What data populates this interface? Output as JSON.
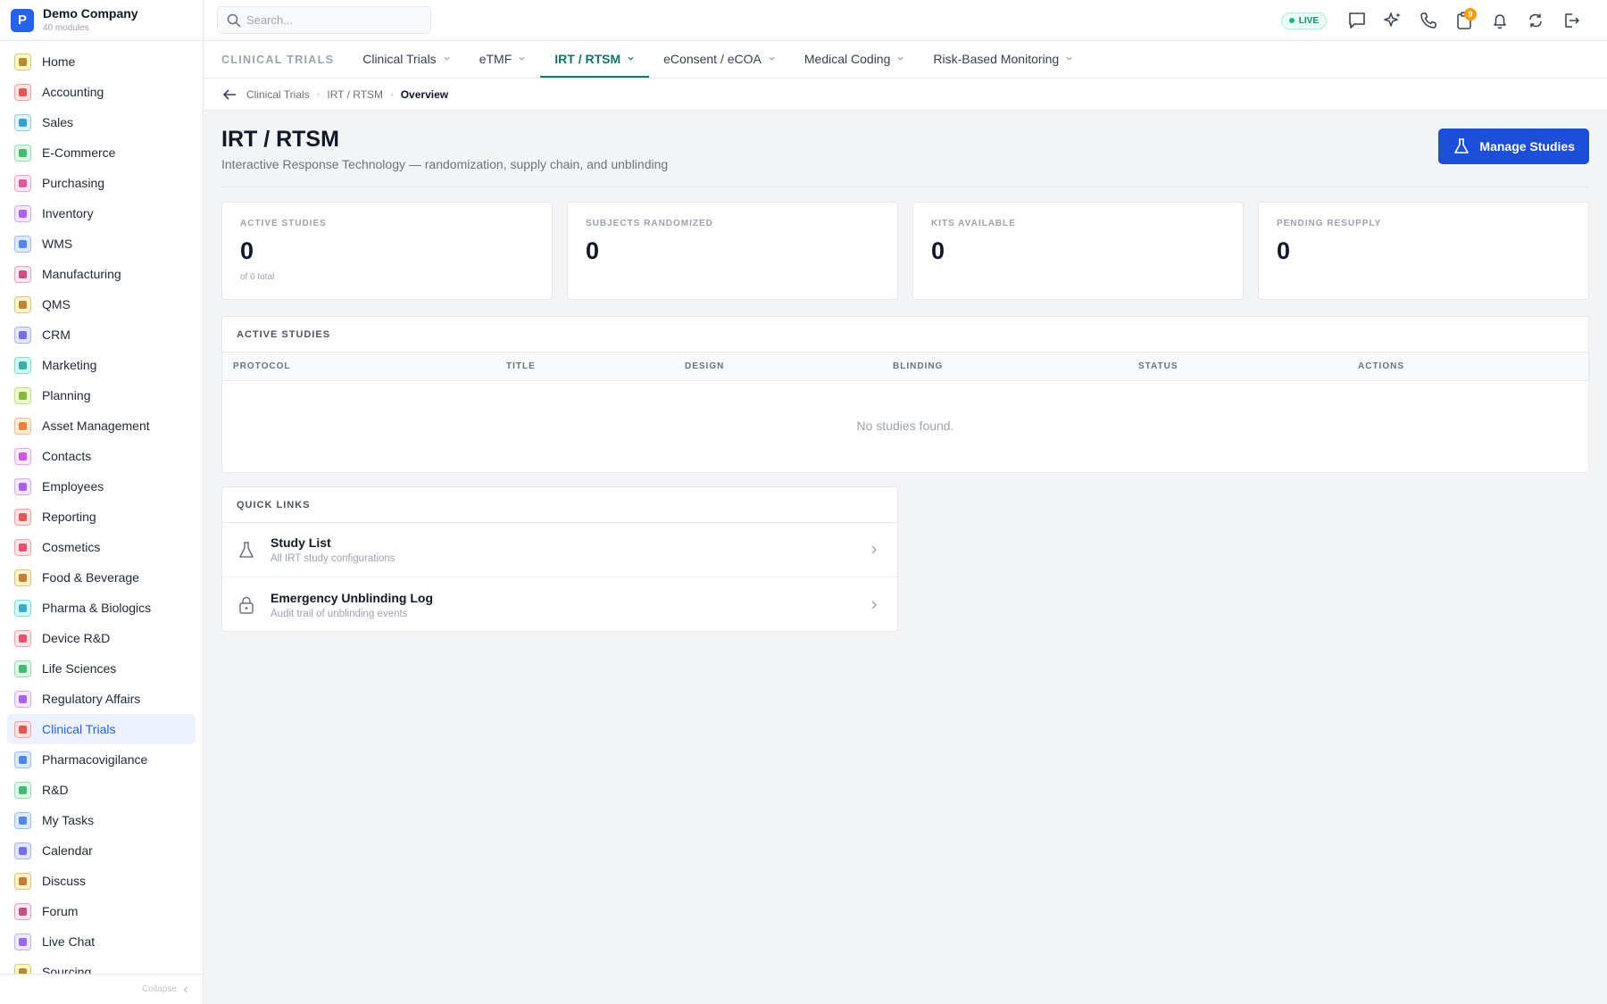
{
  "company": {
    "initial": "P",
    "name": "Demo Company",
    "modules": "40 modules"
  },
  "sidebar": {
    "items": [
      {
        "label": "Home",
        "icon": "home-icon",
        "color": "#a16207",
        "bg": "#fef9c3"
      },
      {
        "label": "Accounting",
        "icon": "bank-icon",
        "color": "#dc2626",
        "bg": "#fee2e2"
      },
      {
        "label": "Sales",
        "icon": "sales-icon",
        "color": "#0284c7",
        "bg": "#e0f2fe"
      },
      {
        "label": "E-Commerce",
        "icon": "store-icon",
        "color": "#16a34a",
        "bg": "#dcfce7"
      },
      {
        "label": "Purchasing",
        "icon": "cart-icon",
        "color": "#db2777",
        "bg": "#fce7f3"
      },
      {
        "label": "Inventory",
        "icon": "box-icon",
        "color": "#9333ea",
        "bg": "#f3e8ff"
      },
      {
        "label": "WMS",
        "icon": "warehouse-icon",
        "color": "#2563eb",
        "bg": "#dbeafe"
      },
      {
        "label": "Manufacturing",
        "icon": "factory-icon",
        "color": "#be185d",
        "bg": "#fce7f3"
      },
      {
        "label": "QMS",
        "icon": "check-circle-icon",
        "color": "#a16207",
        "bg": "#fef3c7"
      },
      {
        "label": "CRM",
        "icon": "users-icon",
        "color": "#4f46e5",
        "bg": "#e0e7ff"
      },
      {
        "label": "Marketing",
        "icon": "megaphone-icon",
        "color": "#0d9488",
        "bg": "#ccfbf1"
      },
      {
        "label": "Planning",
        "icon": "calendar-grid-icon",
        "color": "#65a30d",
        "bg": "#ecfccb"
      },
      {
        "label": "Asset Management",
        "icon": "tools-icon",
        "color": "#ea580c",
        "bg": "#ffedd5"
      },
      {
        "label": "Contacts",
        "icon": "contact-card-icon",
        "color": "#c026d3",
        "bg": "#fae8ff"
      },
      {
        "label": "Employees",
        "icon": "badge-icon",
        "color": "#9333ea",
        "bg": "#f3e8ff"
      },
      {
        "label": "Reporting",
        "icon": "bar-chart-icon",
        "color": "#dc2626",
        "bg": "#fee2e2"
      },
      {
        "label": "Cosmetics",
        "icon": "lotus-icon",
        "color": "#e11d48",
        "bg": "#ffe4e6"
      },
      {
        "label": "Food & Beverage",
        "icon": "utensils-icon",
        "color": "#b45309",
        "bg": "#fef3c7"
      },
      {
        "label": "Pharma & Biologics",
        "icon": "pill-icon",
        "color": "#0891b2",
        "bg": "#cffafe"
      },
      {
        "label": "Device R&D",
        "icon": "device-icon",
        "color": "#e11d48",
        "bg": "#ffe4e6"
      },
      {
        "label": "Life Sciences",
        "icon": "microscope-icon",
        "color": "#16a34a",
        "bg": "#dcfce7"
      },
      {
        "label": "Regulatory Affairs",
        "icon": "gavel-icon",
        "color": "#9333ea",
        "bg": "#f3e8ff"
      },
      {
        "label": "Clinical Trials",
        "icon": "clipboard-icon",
        "color": "#dc2626",
        "bg": "#fee2e2",
        "active": true
      },
      {
        "label": "Pharmacovigilance",
        "icon": "shield-icon",
        "color": "#2563eb",
        "bg": "#dbeafe"
      },
      {
        "label": "R&D",
        "icon": "flask-icon",
        "color": "#16a34a",
        "bg": "#dcfce7"
      },
      {
        "label": "My Tasks",
        "icon": "checklist-icon",
        "color": "#2563eb",
        "bg": "#dbeafe"
      },
      {
        "label": "Calendar",
        "icon": "calendar-icon",
        "color": "#4f46e5",
        "bg": "#e0e7ff"
      },
      {
        "label": "Discuss",
        "icon": "chat-icon",
        "color": "#b45309",
        "bg": "#fef3c7"
      },
      {
        "label": "Forum",
        "icon": "forum-icon",
        "color": "#be185d",
        "bg": "#fce7f3"
      },
      {
        "label": "Live Chat",
        "icon": "headset-icon",
        "color": "#7c3aed",
        "bg": "#ede9fe"
      },
      {
        "label": "Sourcing",
        "icon": "sourcing-icon",
        "color": "#a16207",
        "bg": "#fef9c3"
      }
    ],
    "collapse_label": "Collapse"
  },
  "topbar": {
    "search_placeholder": "Search...",
    "live_label": "LIVE",
    "notification_badge": "9"
  },
  "module_tabs": {
    "title": "CLINICAL TRIALS",
    "tabs": [
      {
        "label": "Clinical Trials"
      },
      {
        "label": "eTMF"
      },
      {
        "label": "IRT / RTSM",
        "active": true
      },
      {
        "label": "eConsent / eCOA"
      },
      {
        "label": "Medical Coding"
      },
      {
        "label": "Risk-Based Monitoring"
      }
    ]
  },
  "breadcrumb": [
    "Clinical Trials",
    "IRT / RTSM",
    "Overview"
  ],
  "page": {
    "title": "IRT / RTSM",
    "subtitle": "Interactive Response Technology — randomization, supply chain, and unblinding",
    "primary_action": "Manage Studies"
  },
  "stats": [
    {
      "label": "ACTIVE STUDIES",
      "value": "0",
      "hint": "of 0 total"
    },
    {
      "label": "SUBJECTS RANDOMIZED",
      "value": "0",
      "hint": ""
    },
    {
      "label": "KITS AVAILABLE",
      "value": "0",
      "hint": ""
    },
    {
      "label": "PENDING RESUPPLY",
      "value": "0",
      "hint": ""
    }
  ],
  "studies_table": {
    "title": "ACTIVE STUDIES",
    "columns": [
      "PROTOCOL",
      "TITLE",
      "DESIGN",
      "BLINDING",
      "STATUS",
      "ACTIONS"
    ],
    "empty_text": "No studies found."
  },
  "quick_links": {
    "title": "QUICK LINKS",
    "items": [
      {
        "title": "Study List",
        "desc": "All IRT study configurations",
        "icon": "flask-icon"
      },
      {
        "title": "Emergency Unblinding Log",
        "desc": "Audit trail of unblinding events",
        "icon": "lock-icon"
      }
    ]
  }
}
